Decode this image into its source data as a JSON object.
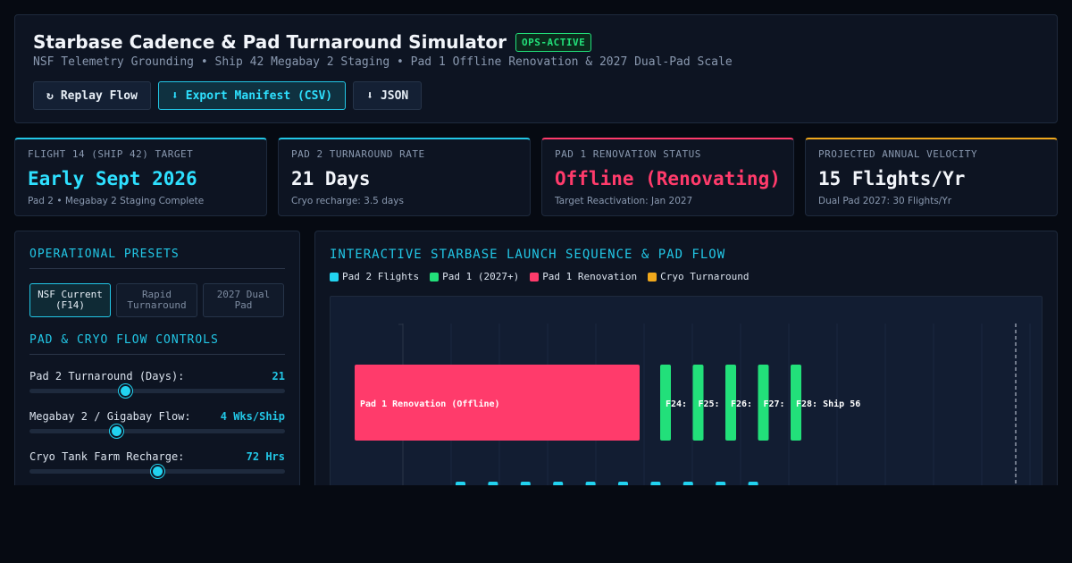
{
  "header": {
    "title": "Starbase Cadence & Pad Turnaround Simulator",
    "badge": "OPS-ACTIVE",
    "subtitle": "NSF Telemetry Grounding • Ship 42 Megabay 2 Staging • Pad 1 Offline Renovation & 2027 Dual-Pad Scale",
    "buttons": [
      {
        "icon": "↻",
        "label": "Replay Flow"
      },
      {
        "icon": "⬇",
        "label": "Export Manifest (CSV)"
      },
      {
        "icon": "⬇",
        "label": "JSON"
      }
    ]
  },
  "cards": [
    {
      "label": "FLIGHT 14 (SHIP 42) TARGET",
      "value": "Early Sept 2026",
      "note": "Pad 2 • Megabay 2 Staging Complete",
      "accent": "#22c7e6",
      "value_color": "#2ee0ff"
    },
    {
      "label": "PAD 2 TURNAROUND RATE",
      "value": "21 Days",
      "note": "Cryo recharge: 3.5 days",
      "accent": "#22c7e6",
      "value_color": "#f2f5fa"
    },
    {
      "label": "PAD 1 RENOVATION STATUS",
      "value": "Offline (Renovating)",
      "note": "Target Reactivation: Jan 2027",
      "accent": "#ff3b6b",
      "value_color": "#ff3b6b"
    },
    {
      "label": "PROJECTED ANNUAL VELOCITY",
      "value": "15 Flights/Yr",
      "note": "Dual Pad 2027: 30 Flights/Yr",
      "accent": "#f0a81c",
      "value_color": "#f2f5fa"
    }
  ],
  "left": {
    "presets_title": "OPERATIONAL PRESETS",
    "presets": [
      "NSF Current (F14)",
      "Rapid Turnaround",
      "2027 Dual Pad"
    ],
    "controls_title": "PAD & CRYO FLOW CONTROLS",
    "controls": [
      {
        "label": "Pad 2 Turnaround (Days):",
        "value": "21",
        "fraction": 0.375
      },
      {
        "label": "Megabay 2 / Gigabay Flow:",
        "value": "4 Wks/Ship",
        "fraction": 0.34
      },
      {
        "label": "Cryo Tank Farm Recharge:",
        "value": "72 Hrs",
        "fraction": 0.5
      }
    ]
  },
  "right": {
    "title": "INTERACTIVE STARBASE LAUNCH SEQUENCE & PAD FLOW",
    "legend": [
      {
        "label": "Pad 2 Flights",
        "color": "#22d3f0"
      },
      {
        "label": "Pad 1 (2027+)",
        "color": "#22e07a"
      },
      {
        "label": "Pad 1 Renovation",
        "color": "#ff3b6b"
      },
      {
        "label": "Cryo Turnaround",
        "color": "#f0a81c"
      }
    ],
    "renovation_label": "Pad 1 Renovation (Offline)",
    "pad1_flight_labels": [
      "F24: ",
      "F25: S",
      "F26: S",
      "F27: S",
      "F28: Ship 56"
    ]
  }
}
